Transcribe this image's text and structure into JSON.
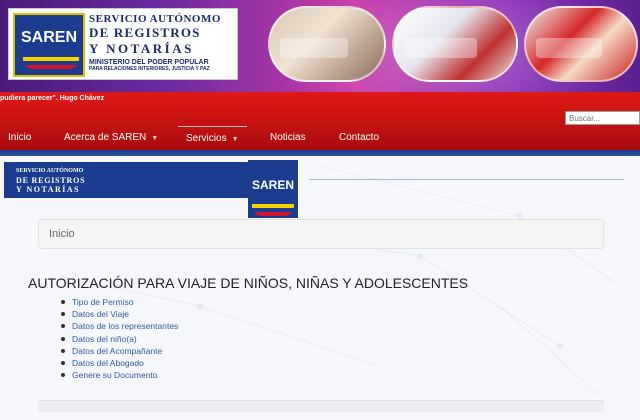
{
  "header": {
    "logo_badge": "SAREN",
    "logo_line1": "SERVICIO AUTÓNOMO",
    "logo_line2": "DE REGISTROS",
    "logo_line3": "Y NOTARÍAS",
    "logo_line4": "MINISTERIO DEL PODER POPULAR",
    "logo_line5": "PARA RELACIONES INTERIORES, JUSTICIA Y PAZ",
    "photo_icons": [
      "photo-documents",
      "photo-registry-office",
      "photo-staff"
    ]
  },
  "topbar": {
    "quote": "pudiera parecer\". Hugo Chávez",
    "search_placeholder": "Buscar..."
  },
  "nav": {
    "items": [
      {
        "label": "Inicio",
        "dropdown": false,
        "active": false
      },
      {
        "label": "Acerca de SAREN",
        "dropdown": true,
        "active": false
      },
      {
        "label": "Servicios",
        "dropdown": true,
        "active": true
      },
      {
        "label": "Noticias",
        "dropdown": false,
        "active": false
      },
      {
        "label": "Contacto",
        "dropdown": false,
        "active": false
      }
    ],
    "caret_glyph": "▼"
  },
  "banner": {
    "line1": "SERVICIO AUTÓNOMO",
    "line2": "DE REGISTROS",
    "line3": "Y NOTARÍAS",
    "badge": "SAREN"
  },
  "breadcrumb": {
    "current": "Inicio"
  },
  "main": {
    "title": "AUTORIZACIÓN PARA VIAJE DE NIÑOS, NIÑAS Y ADOLESCENTES",
    "steps": [
      "Tipo de Permiso",
      "Datos del Viaje",
      "Datos de los representantes",
      "Datos del niño(a)",
      "Datos del Acompañante",
      "Datos del Abogado",
      "Genere su Documento"
    ]
  },
  "colors": {
    "brand_blue": "#1c3d8f",
    "nav_red": "#c41212",
    "link_blue": "#2e5da8",
    "flag_yellow": "#f7d300"
  }
}
